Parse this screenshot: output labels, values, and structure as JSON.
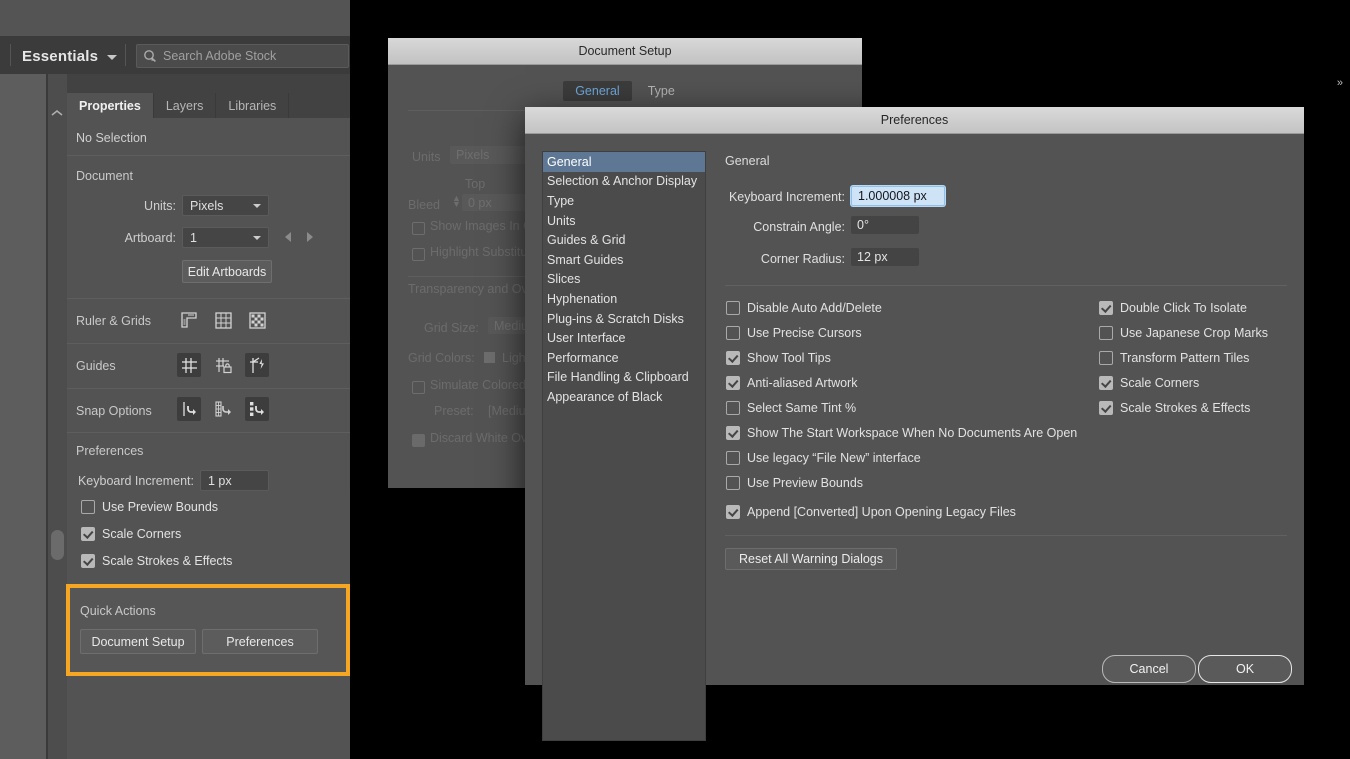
{
  "app": {
    "workspace": "Essentials",
    "search_placeholder": "Search Adobe Stock"
  },
  "panel": {
    "tabs": [
      {
        "label": "Properties",
        "active": true
      },
      {
        "label": "Layers",
        "active": false
      },
      {
        "label": "Libraries",
        "active": false
      }
    ],
    "selection_state": "No Selection",
    "document": {
      "section_label": "Document",
      "units_label": "Units:",
      "units_value": "Pixels",
      "artboard_label": "Artboard:",
      "artboard_value": "1",
      "edit_artboards_label": "Edit Artboards"
    },
    "ruler_grids": {
      "label": "Ruler & Grids",
      "icons": [
        "ruler-icon",
        "grid-icon",
        "transparency-grid-icon"
      ]
    },
    "guides": {
      "label": "Guides",
      "icons": [
        "show-guides-icon",
        "lock-guides-icon",
        "smart-guides-icon"
      ]
    },
    "snap_options": {
      "label": "Snap Options",
      "icons": [
        "snap-to-point-icon",
        "snap-to-grid-icon",
        "snap-to-pixel-icon"
      ]
    },
    "preferences": {
      "section_label": "Preferences",
      "keyboard_increment_label": "Keyboard Increment:",
      "keyboard_increment_value": "1 px",
      "checkboxes": [
        {
          "label": "Use Preview Bounds",
          "checked": false
        },
        {
          "label": "Scale Corners",
          "checked": true
        },
        {
          "label": "Scale Strokes & Effects",
          "checked": true
        }
      ]
    },
    "quick_actions": {
      "section_label": "Quick Actions",
      "highlight_color": "#f5a623",
      "buttons": [
        {
          "label": "Document Setup"
        },
        {
          "label": "Preferences"
        }
      ]
    }
  },
  "document_setup_dialog": {
    "title": "Document Setup",
    "tabs": [
      {
        "label": "General",
        "active": true
      },
      {
        "label": "Type",
        "active": false
      }
    ],
    "units_label": "Units",
    "units_value": "Pixels",
    "top_label": "Top",
    "bleed_label": "Bleed",
    "bleed_value": "0 px",
    "show_images_label": "Show Images In Outline Mode",
    "highlight_subst_label": "Highlight Substituted Fonts",
    "transparency_label": "Transparency and Overprint Options",
    "grid_size_label": "Grid Size:",
    "grid_size_value": "Medium",
    "grid_colors_label": "Grid Colors:",
    "grid_colors_value": "Light",
    "simulate_label": "Simulate Colored Paper",
    "preset_label": "Preset:",
    "preset_value": "[Medium Resolution]",
    "discard_label": "Discard White Overprint"
  },
  "preferences_dialog": {
    "title": "Preferences",
    "categories": [
      {
        "label": "General",
        "selected": true
      },
      {
        "label": "Selection & Anchor Display",
        "selected": false
      },
      {
        "label": "Type",
        "selected": false
      },
      {
        "label": "Units",
        "selected": false
      },
      {
        "label": "Guides & Grid",
        "selected": false
      },
      {
        "label": "Smart Guides",
        "selected": false
      },
      {
        "label": "Slices",
        "selected": false
      },
      {
        "label": "Hyphenation",
        "selected": false
      },
      {
        "label": "Plug-ins & Scratch Disks",
        "selected": false
      },
      {
        "label": "User Interface",
        "selected": false
      },
      {
        "label": "Performance",
        "selected": false
      },
      {
        "label": "File Handling & Clipboard",
        "selected": false
      },
      {
        "label": "Appearance of Black",
        "selected": false
      }
    ],
    "pane_title": "General",
    "fields": [
      {
        "label": "Keyboard Increment:",
        "value": "1.000008 px",
        "focused": true
      },
      {
        "label": "Constrain Angle:",
        "value": "0°",
        "focused": false
      },
      {
        "label": "Corner Radius:",
        "value": "12 px",
        "focused": false
      }
    ],
    "checkboxes_left": [
      {
        "label": "Disable Auto Add/Delete",
        "checked": false
      },
      {
        "label": "Use Precise Cursors",
        "checked": false
      },
      {
        "label": "Show Tool Tips",
        "checked": true
      },
      {
        "label": "Anti-aliased Artwork",
        "checked": true
      },
      {
        "label": "Select Same Tint %",
        "checked": false
      },
      {
        "label": "Show The Start Workspace When No Documents Are Open",
        "checked": true
      },
      {
        "label": "Use legacy “File New” interface",
        "checked": false
      },
      {
        "label": "Use Preview Bounds",
        "checked": false
      },
      {
        "label": "Append [Converted] Upon Opening Legacy Files",
        "checked": true
      }
    ],
    "checkboxes_right": [
      {
        "label": "Double Click To Isolate",
        "checked": true
      },
      {
        "label": "Use Japanese Crop Marks",
        "checked": false
      },
      {
        "label": "Transform Pattern Tiles",
        "checked": false
      },
      {
        "label": "Scale Corners",
        "checked": true
      },
      {
        "label": "Scale Strokes & Effects",
        "checked": true
      }
    ],
    "reset_button": "Reset All Warning Dialogs",
    "cancel_button": "Cancel",
    "ok_button": "OK",
    "accent_selected": "#5d7794"
  }
}
